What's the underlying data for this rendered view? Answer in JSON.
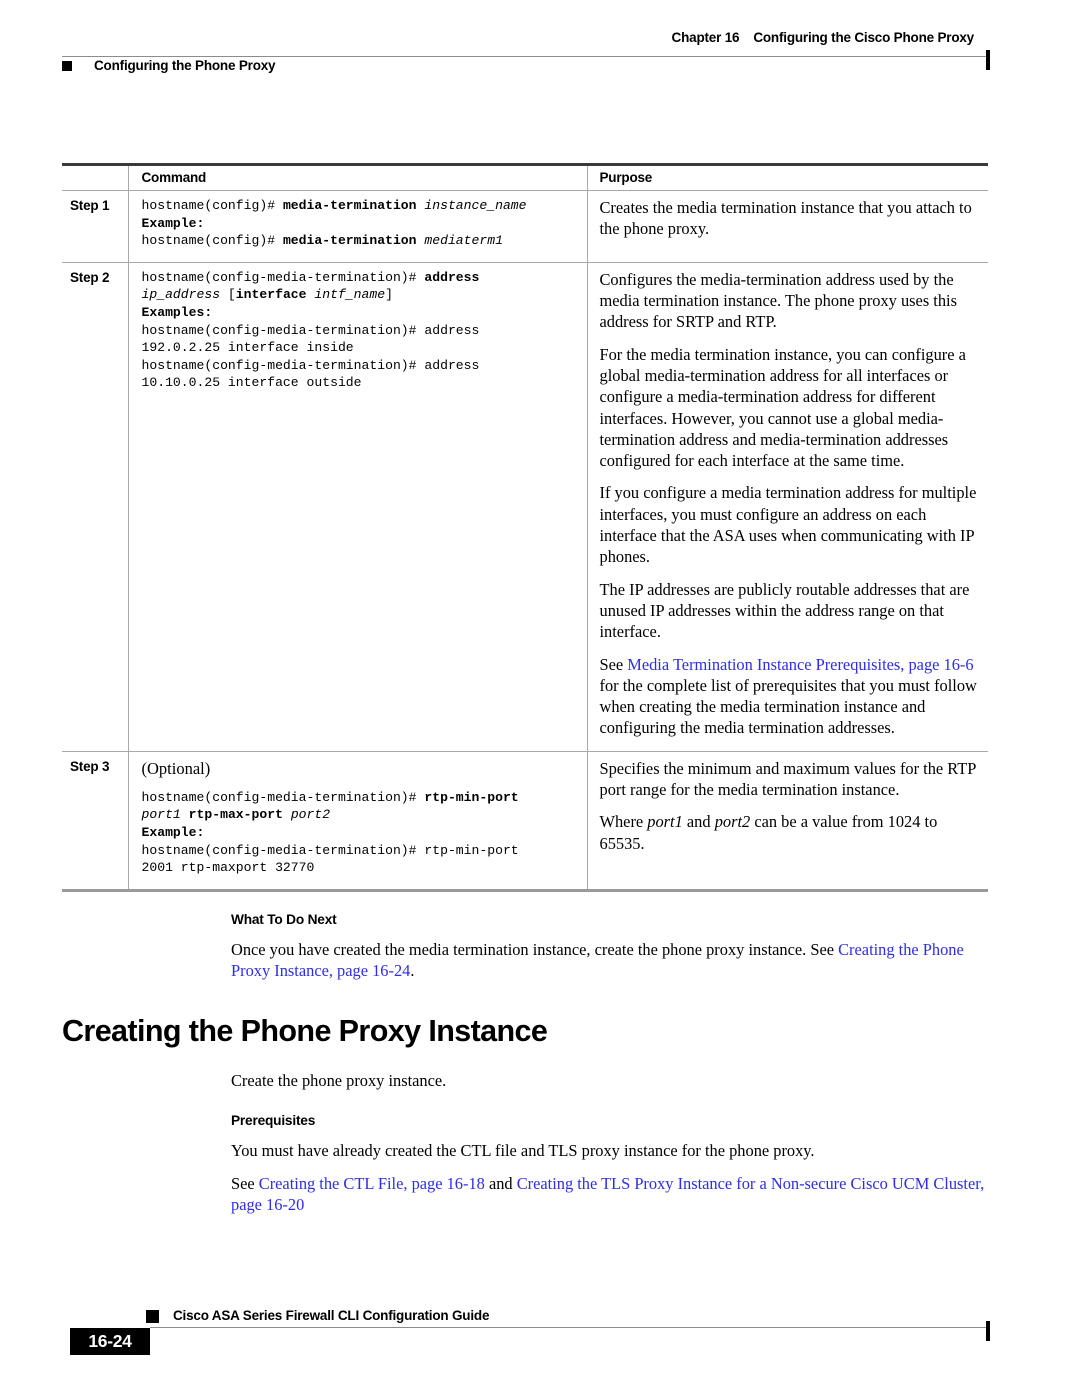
{
  "header": {
    "chapter_label": "Chapter 16",
    "chapter_title": "Configuring the Cisco Phone Proxy",
    "section_title": "Configuring the Phone Proxy"
  },
  "table": {
    "columns": {
      "step": "",
      "command": "Command",
      "purpose": "Purpose"
    },
    "rows": [
      {
        "step": "Step 1",
        "command_lines": [
          {
            "type": "cli",
            "segments": [
              {
                "style": "plain",
                "text": "hostname(config)# "
              },
              {
                "style": "bold",
                "text": "media-termination "
              },
              {
                "style": "italic",
                "text": "instance_name"
              }
            ]
          },
          {
            "type": "label",
            "text": "Example:"
          },
          {
            "type": "cli",
            "segments": [
              {
                "style": "plain",
                "text": "hostname(config)# "
              },
              {
                "style": "bold",
                "text": "media-termination "
              },
              {
                "style": "italic",
                "text": "mediaterm1"
              }
            ]
          }
        ],
        "purpose_paragraphs": [
          [
            {
              "style": "plain",
              "text": "Creates the media termination instance that you attach to the phone proxy."
            }
          ]
        ]
      },
      {
        "step": "Step 2",
        "command_lines": [
          {
            "type": "cli",
            "segments": [
              {
                "style": "plain",
                "text": "hostname(config-media-termination)# "
              },
              {
                "style": "bold",
                "text": "address"
              },
              {
                "style": "plain",
                "text": "\n"
              },
              {
                "style": "italic",
                "text": "ip_address"
              },
              {
                "style": "plain",
                "text": " ["
              },
              {
                "style": "bold",
                "text": "interface"
              },
              {
                "style": "plain",
                "text": " "
              },
              {
                "style": "italic",
                "text": "intf_name"
              },
              {
                "style": "plain",
                "text": "]"
              }
            ]
          },
          {
            "type": "label",
            "text": "Examples:"
          },
          {
            "type": "cli",
            "segments": [
              {
                "style": "plain",
                "text": "hostname(config-media-termination)# address\n192.0.2.25 interface inside"
              }
            ]
          },
          {
            "type": "cli",
            "segments": [
              {
                "style": "plain",
                "text": "hostname(config-media-termination)# address\n10.10.0.25 interface outside"
              }
            ]
          }
        ],
        "purpose_paragraphs": [
          [
            {
              "style": "plain",
              "text": "Configures the media-termination address used by the media termination instance. The phone proxy uses this address for SRTP and RTP."
            }
          ],
          [
            {
              "style": "plain",
              "text": "For the media termination instance, you can configure a global media-termination address for all interfaces or configure a media-termination address for different interfaces. However, you cannot use a global media-termination address and media-termination addresses configured for each interface at the same time."
            }
          ],
          [
            {
              "style": "plain",
              "text": "If you configure a media termination address for multiple interfaces, you must configure an address on each interface that the ASA uses when communicating with IP phones."
            }
          ],
          [
            {
              "style": "plain",
              "text": "The IP addresses are publicly routable addresses that are unused IP addresses within the address range on that interface."
            }
          ],
          [
            {
              "style": "plain",
              "text": "See "
            },
            {
              "style": "link",
              "text": "Media Termination Instance Prerequisites, page 16-6"
            },
            {
              "style": "plain",
              "text": " for the complete list of prerequisites that you must follow when creating the media termination instance and configuring the media termination addresses."
            }
          ]
        ]
      },
      {
        "step": "Step 3",
        "optional_label": "(Optional)",
        "command_lines": [
          {
            "type": "cli",
            "segments": [
              {
                "style": "plain",
                "text": "hostname(config-media-termination)# "
              },
              {
                "style": "bold",
                "text": "rtp-min-port"
              },
              {
                "style": "plain",
                "text": "\n"
              },
              {
                "style": "italic",
                "text": "port1"
              },
              {
                "style": "plain",
                "text": " "
              },
              {
                "style": "bold",
                "text": "rtp-max-port"
              },
              {
                "style": "plain",
                "text": " "
              },
              {
                "style": "italic",
                "text": "port2"
              }
            ]
          },
          {
            "type": "label",
            "text": "Example:"
          },
          {
            "type": "cli",
            "segments": [
              {
                "style": "plain",
                "text": "hostname(config-media-termination)# rtp-min-port\n2001 rtp-maxport 32770"
              }
            ]
          }
        ],
        "purpose_paragraphs": [
          [
            {
              "style": "plain",
              "text": "Specifies the minimum and maximum values for the RTP port range for the media termination instance."
            }
          ],
          [
            {
              "style": "plain",
              "text": "Where "
            },
            {
              "style": "italic",
              "text": "port1"
            },
            {
              "style": "plain",
              "text": " and "
            },
            {
              "style": "italic",
              "text": "port2"
            },
            {
              "style": "plain",
              "text": " can be a value from 1024 to 65535."
            }
          ]
        ]
      }
    ]
  },
  "what_to_do_next": {
    "heading": "What To Do Next",
    "paragraph": [
      {
        "style": "plain",
        "text": "Once you have created the media termination instance, create the phone proxy instance. See "
      },
      {
        "style": "link",
        "text": "Creating the Phone Proxy Instance, page 16-24"
      },
      {
        "style": "plain",
        "text": "."
      }
    ]
  },
  "section": {
    "heading": "Creating the Phone Proxy Instance",
    "intro": [
      {
        "style": "plain",
        "text": "Create the phone proxy instance."
      }
    ],
    "prerequisites_heading": "Prerequisites",
    "prerequisites_paragraph": [
      {
        "style": "plain",
        "text": "You must have already created the CTL file and TLS proxy instance for the phone proxy."
      }
    ],
    "see_paragraph": [
      {
        "style": "plain",
        "text": "See "
      },
      {
        "style": "link",
        "text": "Creating the CTL File, page 16-18"
      },
      {
        "style": "plain",
        "text": " and "
      },
      {
        "style": "link",
        "text": "Creating the TLS Proxy Instance for a Non-secure Cisco UCM Cluster, page 16-20"
      }
    ]
  },
  "footer": {
    "guide_title": "Cisco ASA Series Firewall CLI Configuration Guide",
    "page_number": "16-24"
  },
  "colors": {
    "link": "#2d2df0",
    "rule": "#8c8c8c",
    "table_border": "#a8a8a8",
    "table_top_border": "#3a3a3a"
  }
}
